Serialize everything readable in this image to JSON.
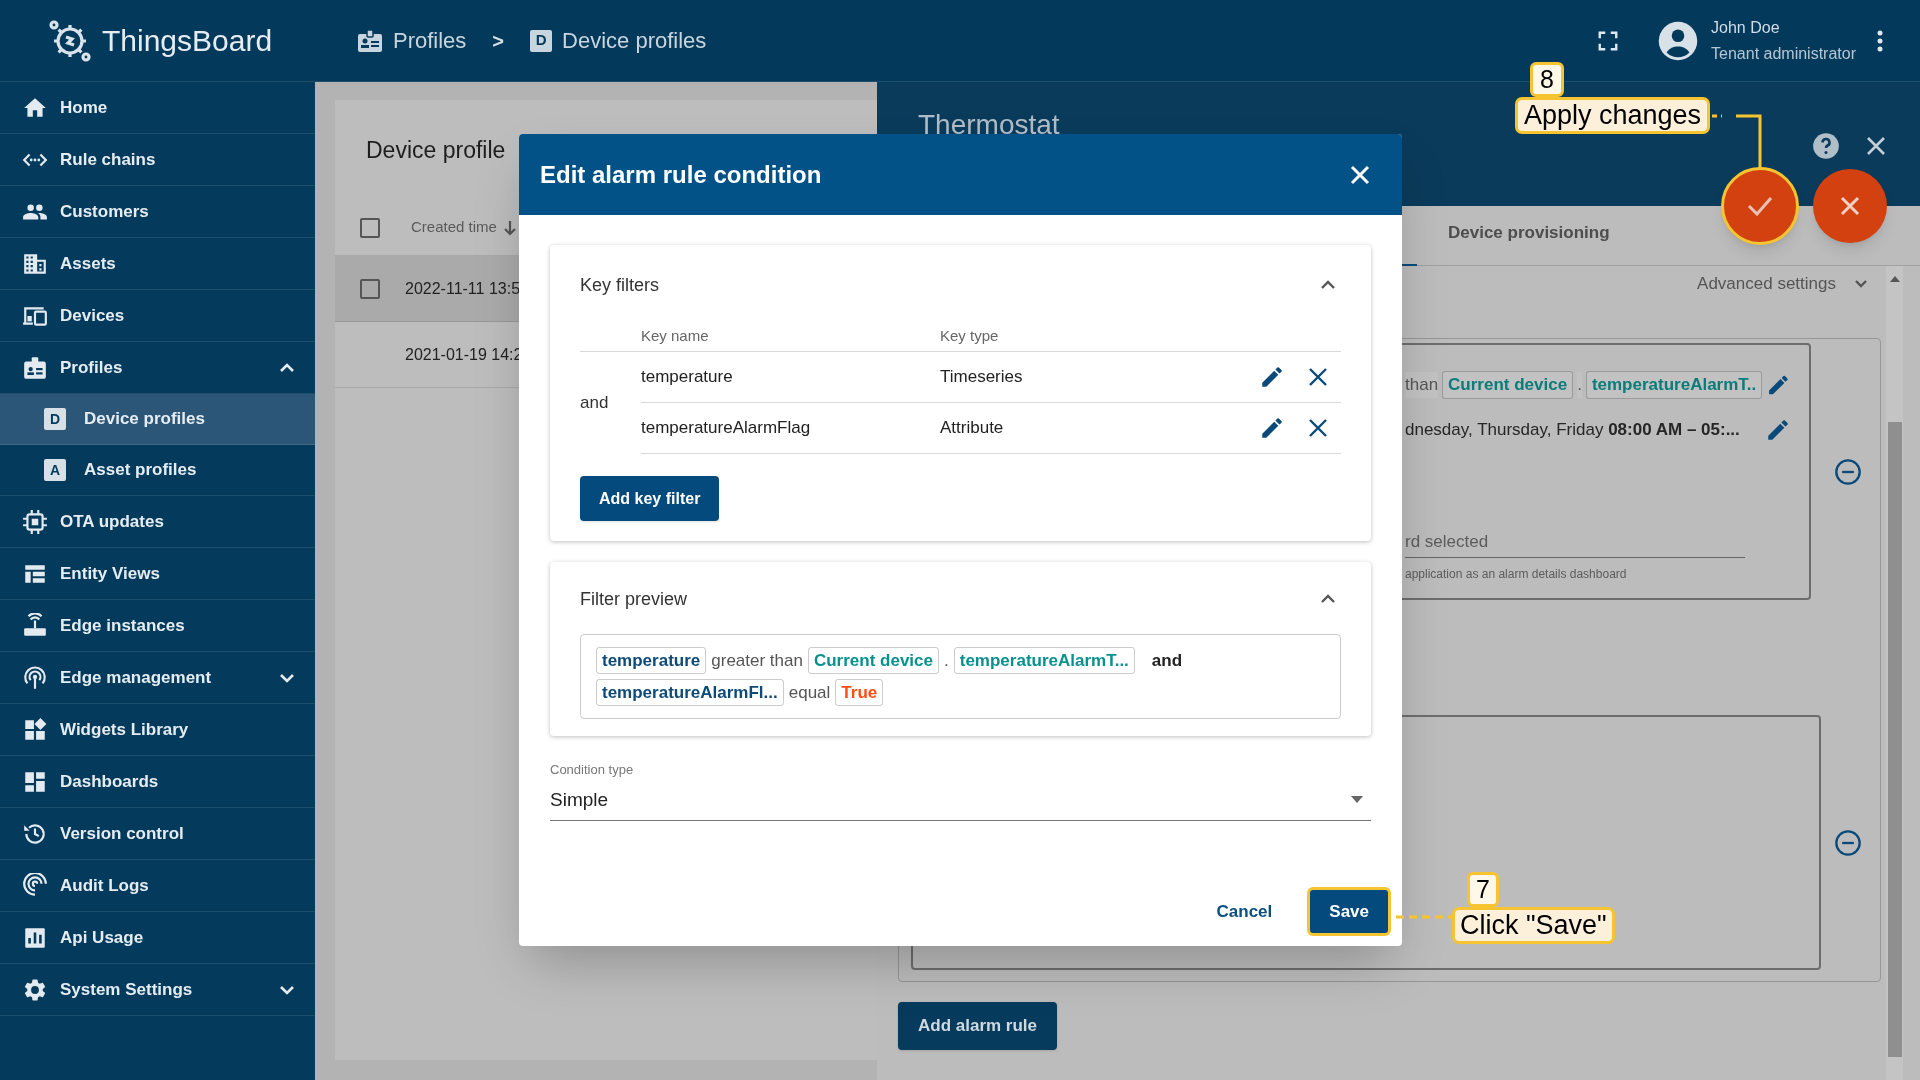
{
  "app": {
    "name": "ThingsBoard"
  },
  "breadcrumb": [
    {
      "label": "Profiles"
    },
    {
      "label": ">",
      "kind": "separator"
    },
    {
      "label": "Device profiles",
      "icon_letter": "D"
    }
  ],
  "user": {
    "name": "John Doe",
    "role": "Tenant administrator"
  },
  "sidebar": {
    "items": [
      {
        "label": "Home",
        "selected": false
      },
      {
        "label": "Rule chains",
        "selected": false
      },
      {
        "label": "Customers",
        "selected": false
      },
      {
        "label": "Assets",
        "selected": false
      },
      {
        "label": "Devices",
        "selected": false
      },
      {
        "label": "Profiles",
        "selected": false,
        "expanded": true,
        "children": [
          {
            "label": "Device profiles",
            "icon_letter": "D",
            "selected": true
          },
          {
            "label": "Asset profiles",
            "icon_letter": "A",
            "selected": false
          }
        ]
      },
      {
        "label": "OTA updates",
        "selected": false
      },
      {
        "label": "Entity Views",
        "selected": false
      },
      {
        "label": "Edge instances",
        "selected": false
      },
      {
        "label": "Edge management",
        "selected": false,
        "expanded": false
      },
      {
        "label": "Widgets Library",
        "selected": false
      },
      {
        "label": "Dashboards",
        "selected": false
      },
      {
        "label": "Version control",
        "selected": false
      },
      {
        "label": "Audit Logs",
        "selected": false
      },
      {
        "label": "Api Usage",
        "selected": false
      },
      {
        "label": "System Settings",
        "selected": false,
        "expanded": false
      }
    ]
  },
  "list_panel": {
    "title": "Device profile",
    "header_checked": false,
    "column": "Created time",
    "rows": [
      {
        "created_time": "2022-11-11 13:5",
        "selectable": true,
        "checked": false,
        "selected": true
      },
      {
        "created_time": "2021-01-19 14:2",
        "selectable": false,
        "selected": false
      }
    ]
  },
  "details_panel": {
    "title": "Thermostat",
    "tab": "Device provisioning",
    "advanced_settings": "Advanced settings",
    "alarm_rule": {
      "condition_tokens": [
        {
          "kind": "operation",
          "text": "than"
        },
        {
          "kind": "source",
          "text": "Current device"
        },
        {
          "kind": "separator",
          "text": "."
        },
        {
          "kind": "source",
          "text": "temperatureAlarmT.."
        }
      ],
      "schedule": "dnesday, Thursday, Friday **08:00 AM – 05:...**",
      "dashboard_value": "rd selected",
      "dashboard_hint": "application as an alarm details dashboard"
    },
    "add_alarm_rule": "Add alarm rule"
  },
  "dialog": {
    "title": "Edit alarm rule condition",
    "key_filters": {
      "title": "Key filters",
      "expanded": true,
      "columns": [
        "Key name",
        "Key type"
      ],
      "operator": "and",
      "rows": [
        {
          "key_name": "temperature",
          "key_type": "Timeseries"
        },
        {
          "key_name": "temperatureAlarmFlag",
          "key_type": "Attribute"
        }
      ],
      "add_button": "Add key filter"
    },
    "filter_preview": {
      "title": "Filter preview",
      "expanded": true,
      "lines": [
        [
          {
            "kind": "key",
            "text": "temperature"
          },
          {
            "kind": "operation",
            "text": "greater than"
          },
          {
            "kind": "source",
            "text": "Current device"
          },
          {
            "kind": "separator",
            "text": "."
          },
          {
            "kind": "source",
            "text": "temperatureAlarmT..."
          },
          {
            "kind": "logic",
            "text": "and"
          }
        ],
        [
          {
            "kind": "key",
            "text": "temperatureAlarmFl..."
          },
          {
            "kind": "operation",
            "text": "equal"
          },
          {
            "kind": "literal",
            "text": "True"
          }
        ]
      ]
    },
    "condition_type": {
      "label": "Condition type",
      "value": "Simple"
    },
    "cancel": "Cancel",
    "save": "Save"
  },
  "annotations": [
    {
      "step": "8",
      "text": "Apply changes"
    },
    {
      "step": "7",
      "text": "Click \"Save\""
    }
  ]
}
